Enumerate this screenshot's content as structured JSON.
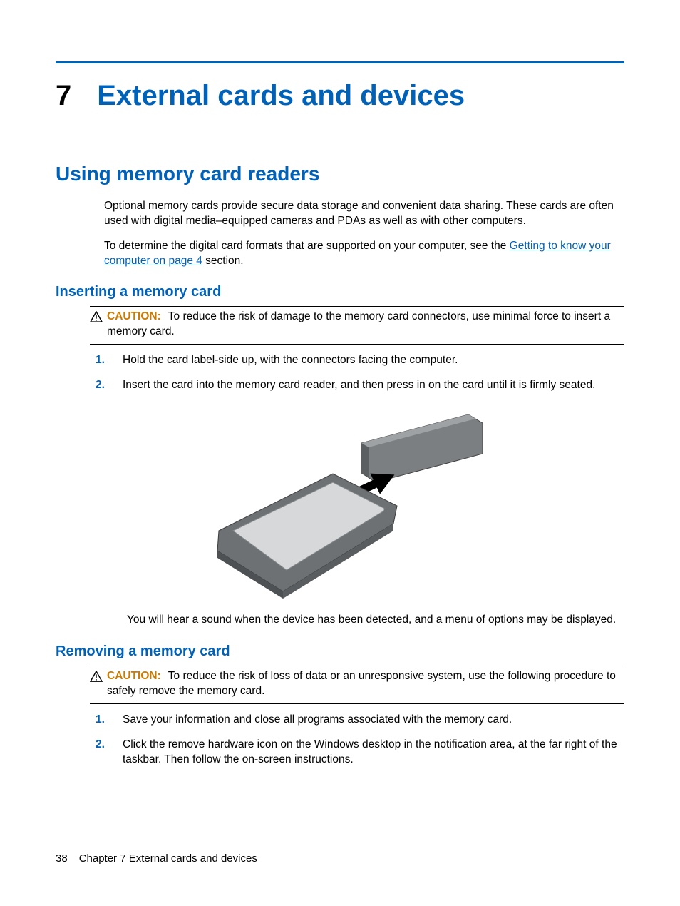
{
  "chapter": {
    "num": "7",
    "title": "External cards and devices"
  },
  "section1": {
    "title": "Using memory card readers",
    "p1": "Optional memory cards provide secure data storage and convenient data sharing. These cards are often used with digital media–equipped cameras and PDAs as well as with other computers.",
    "p2a": "To determine the digital card formats that are supported on your computer, see the ",
    "link": "Getting to know your computer on page 4",
    "p2b": " section."
  },
  "inserting": {
    "title": "Inserting a memory card",
    "caution_label": "CAUTION:",
    "caution_text": "To reduce the risk of damage to the memory card connectors, use minimal force to insert a memory card.",
    "steps": [
      "Hold the card label-side up, with the connectors facing the computer.",
      "Insert the card into the memory card reader, and then press in on the card until it is firmly seated."
    ],
    "after": "You will hear a sound when the device has been detected, and a menu of options may be displayed."
  },
  "removing": {
    "title": "Removing a memory card",
    "caution_label": "CAUTION:",
    "caution_text": "To reduce the risk of loss of data or an unresponsive system, use the following procedure to safely remove the memory card.",
    "steps": [
      "Save your information and close all programs associated with the memory card.",
      "Click the remove hardware icon on the Windows desktop in the notification area, at the far right of the taskbar. Then follow the on-screen instructions."
    ]
  },
  "footer": {
    "page": "38",
    "chapter": "Chapter 7   External cards and devices"
  },
  "list_numbers": [
    "1.",
    "2."
  ]
}
